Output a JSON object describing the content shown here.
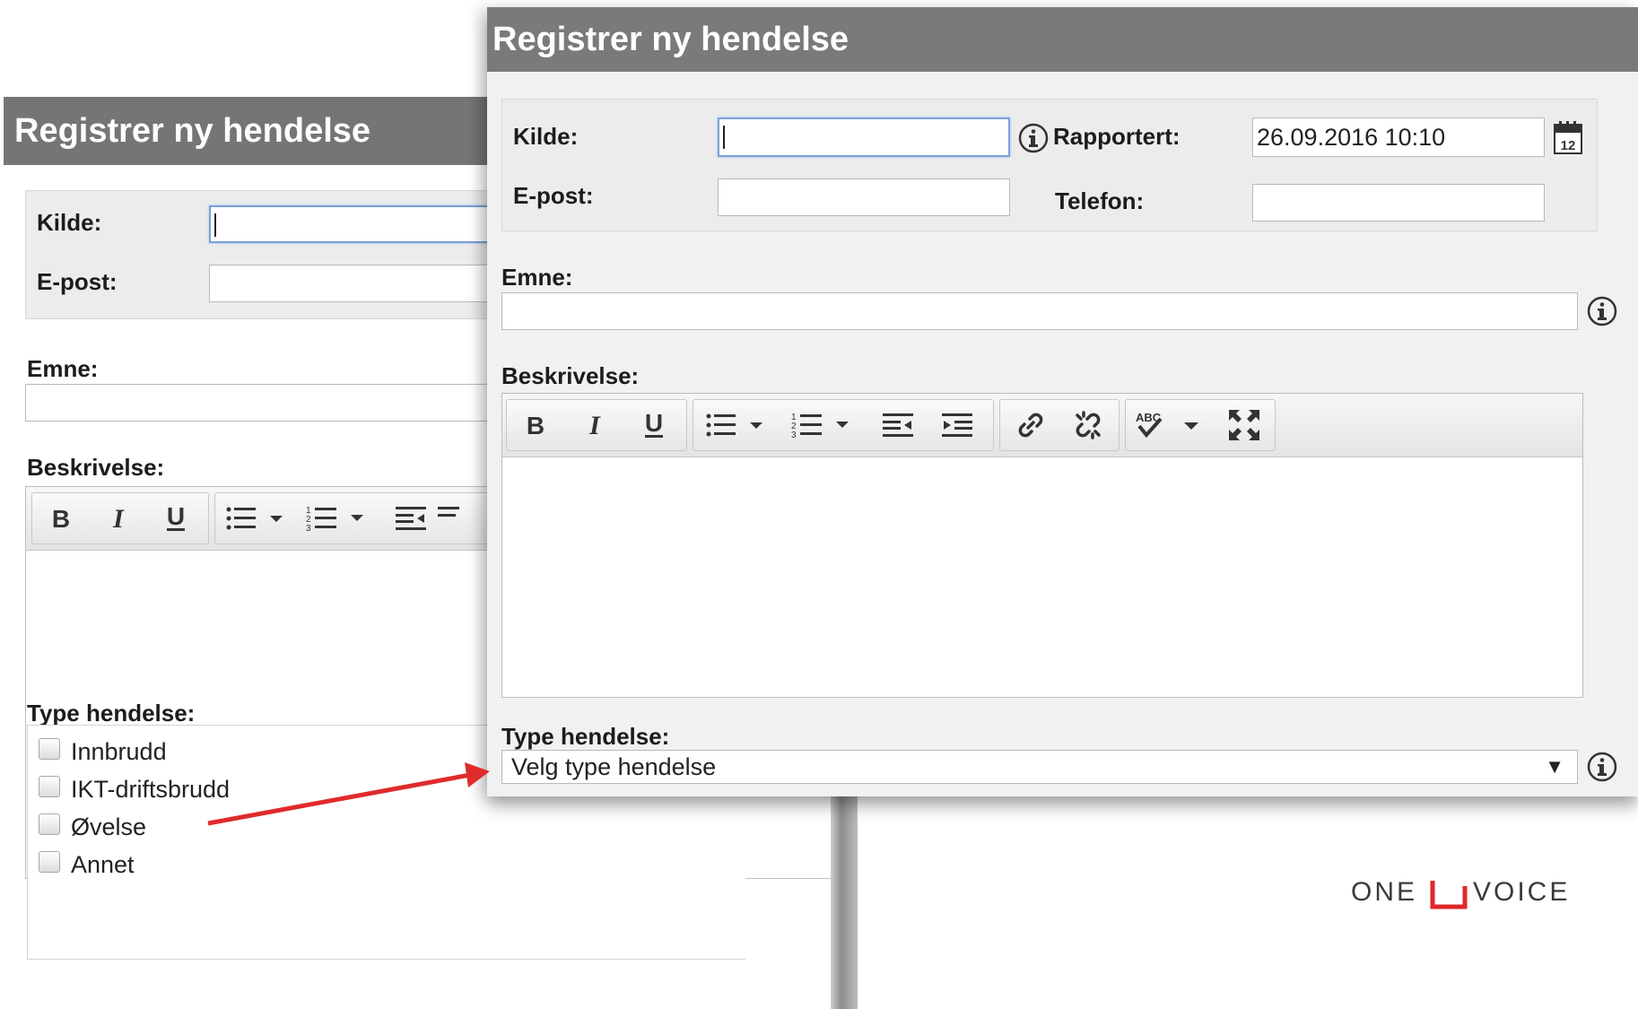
{
  "back_panel": {
    "title": "Registrer ny hendelse",
    "kilde_label": "Kilde:",
    "epost_label": "E-post:",
    "emne_label": "Emne:",
    "beskrivelse_label": "Beskrivelse:",
    "type_label": "Type hendelse:",
    "type_options": [
      "Innbrudd",
      "IKT-driftsbrudd",
      "Øvelse",
      "Annet"
    ]
  },
  "front_panel": {
    "title": "Registrer ny hendelse",
    "kilde_label": "Kilde:",
    "kilde_value": "",
    "rapportert_label": "Rapportert:",
    "rapportert_value": "26.09.2016 10:10",
    "epost_label": "E-post:",
    "epost_value": "",
    "telefon_label": "Telefon:",
    "telefon_value": "",
    "emne_label": "Emne:",
    "emne_value": "",
    "beskrivelse_label": "Beskrivelse:",
    "type_label": "Type hendelse:",
    "type_selected": "Velg type hendelse"
  },
  "toolbar_icons": [
    "bold-icon",
    "italic-icon",
    "underline-icon",
    "bulleted-list-icon",
    "numbered-list-icon",
    "outdent-icon",
    "indent-icon",
    "link-icon",
    "unlink-icon",
    "spellcheck-icon",
    "maximize-icon"
  ],
  "logo": {
    "left": "ONE",
    "right": "VOICE"
  },
  "colors": {
    "titlebar": "#7a7a7a",
    "panel": "#f1f1f1",
    "arrow": "#e02b2b",
    "logo_mark": "#e0262a",
    "focus_border": "#7ba0d8"
  }
}
